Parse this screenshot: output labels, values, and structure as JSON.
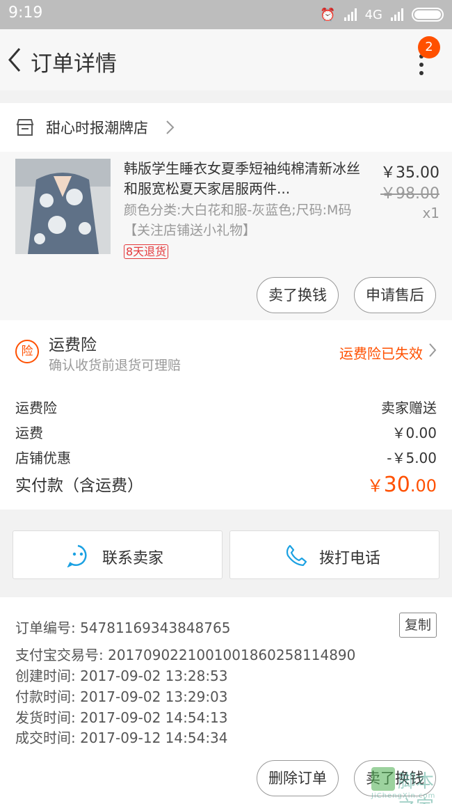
{
  "status_bar": {
    "time": "9:19",
    "network": "4G",
    "battery_level": 1.0
  },
  "nav": {
    "title": "订单详情",
    "badge_count": "2"
  },
  "shop": {
    "name": "甜心时报潮牌店"
  },
  "item": {
    "title": "韩版学生睡衣女夏季短袖纯棉清新冰丝和服宽松夏天家居服两件...",
    "spec": "颜色分类:大白花和服-灰蓝色;尺码:M码【关注店铺送小礼物】",
    "return_tag": "8天退货",
    "price": "￥35.00",
    "original_price": "￥98.00",
    "quantity": "x1",
    "btn_sell": "卖了换钱",
    "btn_aftersale": "申请售后"
  },
  "insurance": {
    "icon_char": "险",
    "title": "运费险",
    "subtitle": "确认收货前退货可理赔",
    "status": "运费险已失效"
  },
  "fees": [
    {
      "label": "运费险",
      "value": "卖家赠送"
    },
    {
      "label": "运费",
      "value": "￥0.00"
    },
    {
      "label": "店铺优惠",
      "value": "-￥5.00"
    }
  ],
  "total": {
    "label": "实付款（含运费）",
    "symbol": "￥",
    "integer": "30",
    "decimal": ".00"
  },
  "contact": {
    "seller": "联系卖家",
    "call": "拨打电话"
  },
  "order_info": {
    "order_no": "订单编号: 54781169343848765",
    "alipay_no": "支付宝交易号: 2017090221001001860258114890",
    "created": "创建时间: 2017-09-02 13:28:53",
    "paid": "付款时间: 2017-09-02 13:29:03",
    "shipped": "发货时间: 2017-09-02 14:54:13",
    "completed": "成交时间: 2017-09-12 14:54:34",
    "copy": "复制"
  },
  "bottom_bar": {
    "delete": "删除订单",
    "sell": "卖了换钱"
  },
  "watermark": {
    "text": "脚本之家",
    "site": "JiChengXin.com"
  },
  "colors": {
    "accent": "#ff5000",
    "return_red": "#e4393c",
    "contact_blue": "#1ba1e2"
  }
}
